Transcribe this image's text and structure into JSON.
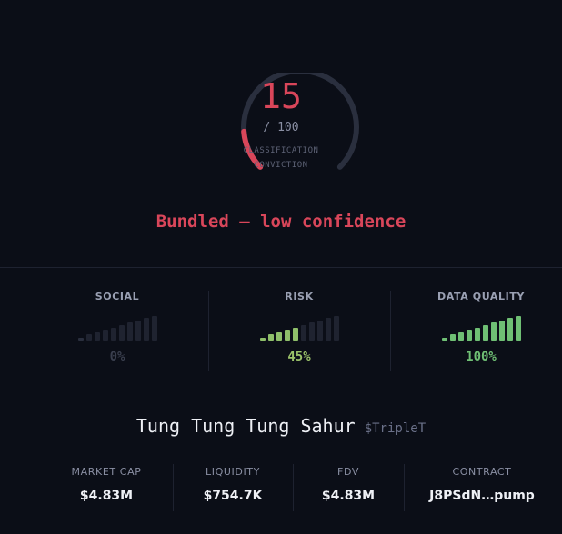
{
  "gauge": {
    "value": "15",
    "max_label": "/ 100",
    "subtitle_line1": "CLASSIFICATION",
    "subtitle_line2": "CONVICTION",
    "fill_fraction": 0.15,
    "track_color": "#2a2f3e",
    "fill_color": "#d9465a"
  },
  "verdict": "Bundled — low confidence",
  "metrics": [
    {
      "label": "SOCIAL",
      "value": "0%",
      "level": 0.0,
      "active_color": "#6fb96f",
      "value_color": "#3a3f4e"
    },
    {
      "label": "RISK",
      "value": "45%",
      "level": 0.45,
      "active_color": "#8fbf6a",
      "value_color": "#9cc46a"
    },
    {
      "label": "DATA QUALITY",
      "value": "100%",
      "level": 1.0,
      "active_color": "#6fbf74",
      "value_color": "#6fbf74"
    }
  ],
  "token": {
    "name": "Tung Tung Tung Sahur",
    "ticker": "$TripleT"
  },
  "stats": [
    {
      "label": "MARKET CAP",
      "value": "$4.83M"
    },
    {
      "label": "LIQUIDITY",
      "value": "$754.7K"
    },
    {
      "label": "FDV",
      "value": "$4.83M"
    },
    {
      "label": "CONTRACT",
      "value": "J8PSdN…pump"
    }
  ]
}
